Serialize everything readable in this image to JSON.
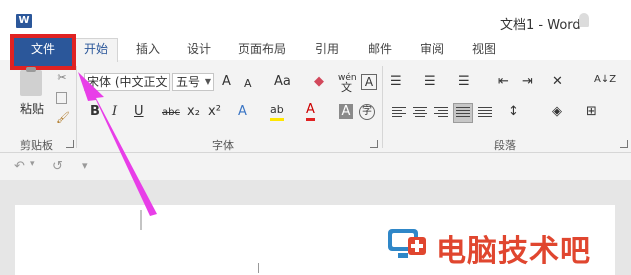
{
  "title_bar": {
    "app_icon": "W",
    "doc_title": "文档1 - Word"
  },
  "tabs": {
    "file": "文件",
    "home": "开始",
    "items": [
      "插入",
      "设计",
      "页面布局",
      "引用",
      "邮件",
      "审阅",
      "视图"
    ]
  },
  "clipboard": {
    "paste_label": "粘贴",
    "group_label": "剪贴板"
  },
  "font": {
    "font_name": "宋体 (中文正文",
    "font_size": "五号",
    "group_label": "字体",
    "buttons": {
      "grow": "A",
      "shrink": "A",
      "change_case": "Aa",
      "phonetic_top": "wén",
      "phonetic_bottom": "文",
      "char_border": "A",
      "bold": "B",
      "italic": "I",
      "underline": "U",
      "strike": "abc",
      "subscript": "x₂",
      "superscript": "x²",
      "text_effect": "A",
      "highlight": "ab",
      "font_color": "A",
      "char_shading": "A",
      "enclose": "字"
    }
  },
  "paragraph": {
    "group_label": "段落",
    "sort_icon": "A↓Z"
  },
  "quick_access": {
    "undo": "↶",
    "redo": "↺",
    "customize": "▾"
  },
  "watermark": {
    "text": "电脑技术吧"
  },
  "colors": {
    "accent": "#2b579a",
    "highlight_box": "#e02222",
    "arrow": "#e83ee8",
    "watermark": "#e0462f"
  }
}
